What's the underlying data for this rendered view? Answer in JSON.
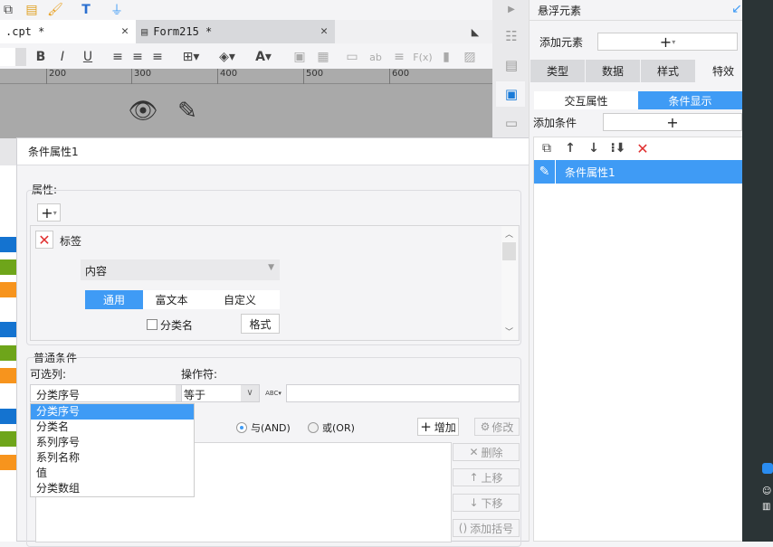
{
  "tabs": [
    {
      "label": ".cpt *",
      "active": true
    },
    {
      "label": "Form215 *",
      "active": false
    }
  ],
  "ruler": [
    "200",
    "300",
    "400",
    "500",
    "600"
  ],
  "dialog": {
    "title": "条件属性1",
    "attr_label": "属性:",
    "attr_item": "标签",
    "content_select": "内容",
    "format_tabs": [
      "通用",
      "富文本",
      "自定义"
    ],
    "checkbox_label": "分类名",
    "format_button": "格式",
    "common_label": "普通条件",
    "column_label": "可选列:",
    "operator_label": "操作符:",
    "column_value": "分类序号",
    "operator_value": "等于",
    "value_input": "",
    "column_options": [
      "分类序号",
      "分类名",
      "系列序号",
      "系列名称",
      "值",
      "分类数组"
    ],
    "and_label": "与(AND)",
    "or_label": "或(OR)",
    "add_button": "增加",
    "modify_button": "修改",
    "delete_button": "删除",
    "up_button": "上移",
    "down_button": "下移",
    "bracket_button": "添加括号"
  },
  "panel": {
    "title": "悬浮元素",
    "add_element": "添加元素",
    "tabs": [
      "类型",
      "数据",
      "样式",
      "特效"
    ],
    "subtabs": [
      "交互属性",
      "条件显示"
    ],
    "add_condition": "添加条件",
    "conditions": [
      "条件属性1"
    ]
  },
  "colors": {
    "accent": "#3f9bf5",
    "blue": "#1473d0",
    "green": "#6ea51a",
    "orange": "#f7941d"
  }
}
